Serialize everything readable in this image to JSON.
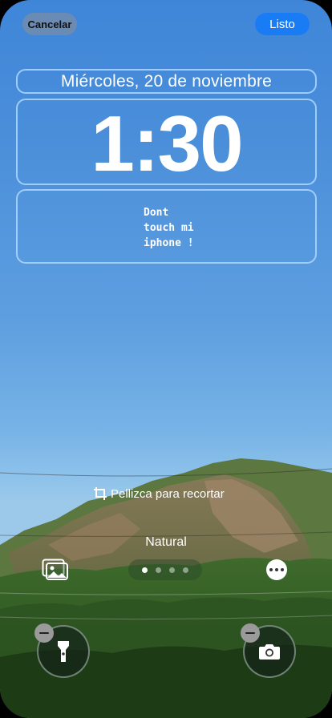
{
  "header": {
    "cancel_label": "Cancelar",
    "done_label": "Listo"
  },
  "lockscreen": {
    "date": "Miércoles, 20 de noviembre",
    "time": "1:30",
    "widget_text": "Dont\ntouch mi\niphone !"
  },
  "editor": {
    "crop_hint": "Pellizca para recortar",
    "filter_name": "Natural",
    "page_count": 4,
    "active_page": 1
  },
  "quick_actions": {
    "left_icon": "flashlight-icon",
    "right_icon": "camera-icon"
  },
  "colors": {
    "accent": "#1a7cf5",
    "widget_border": "#afd7ff"
  }
}
